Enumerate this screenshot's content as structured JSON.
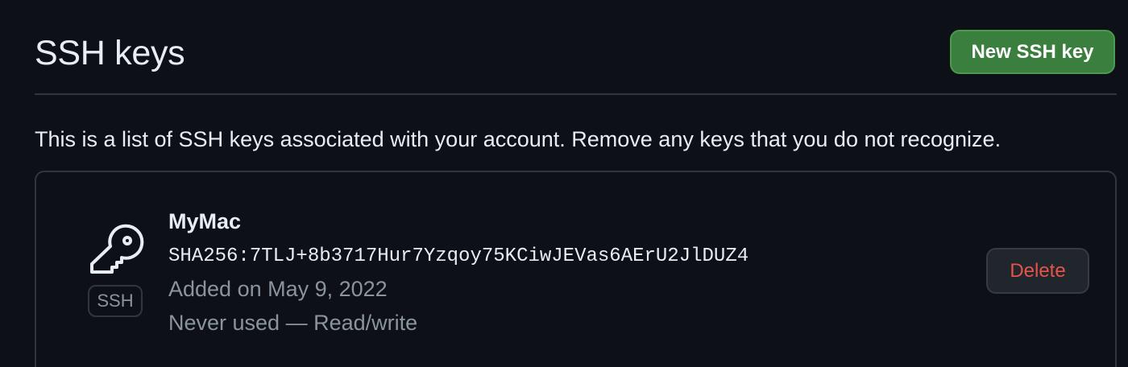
{
  "header": {
    "title": "SSH keys",
    "new_key_button": "New SSH key"
  },
  "description": "This is a list of SSH keys associated with your account. Remove any keys that you do not recognize.",
  "keys": [
    {
      "name": "MyMac",
      "fingerprint": "SHA256:7TLJ+8b3717Hur7Yzqoy75KCiwJEVas6AErU2JlDUZ4",
      "added": "Added on May 9, 2022",
      "usage": "Never used — Read/write",
      "badge": "SSH",
      "icon": "key-icon",
      "delete_label": "Delete"
    }
  ],
  "colors": {
    "background": "#0d1117",
    "primary_button": "#3a7f3e",
    "danger_text": "#e5534b",
    "border": "#30363d",
    "muted_text": "#8b949e"
  }
}
